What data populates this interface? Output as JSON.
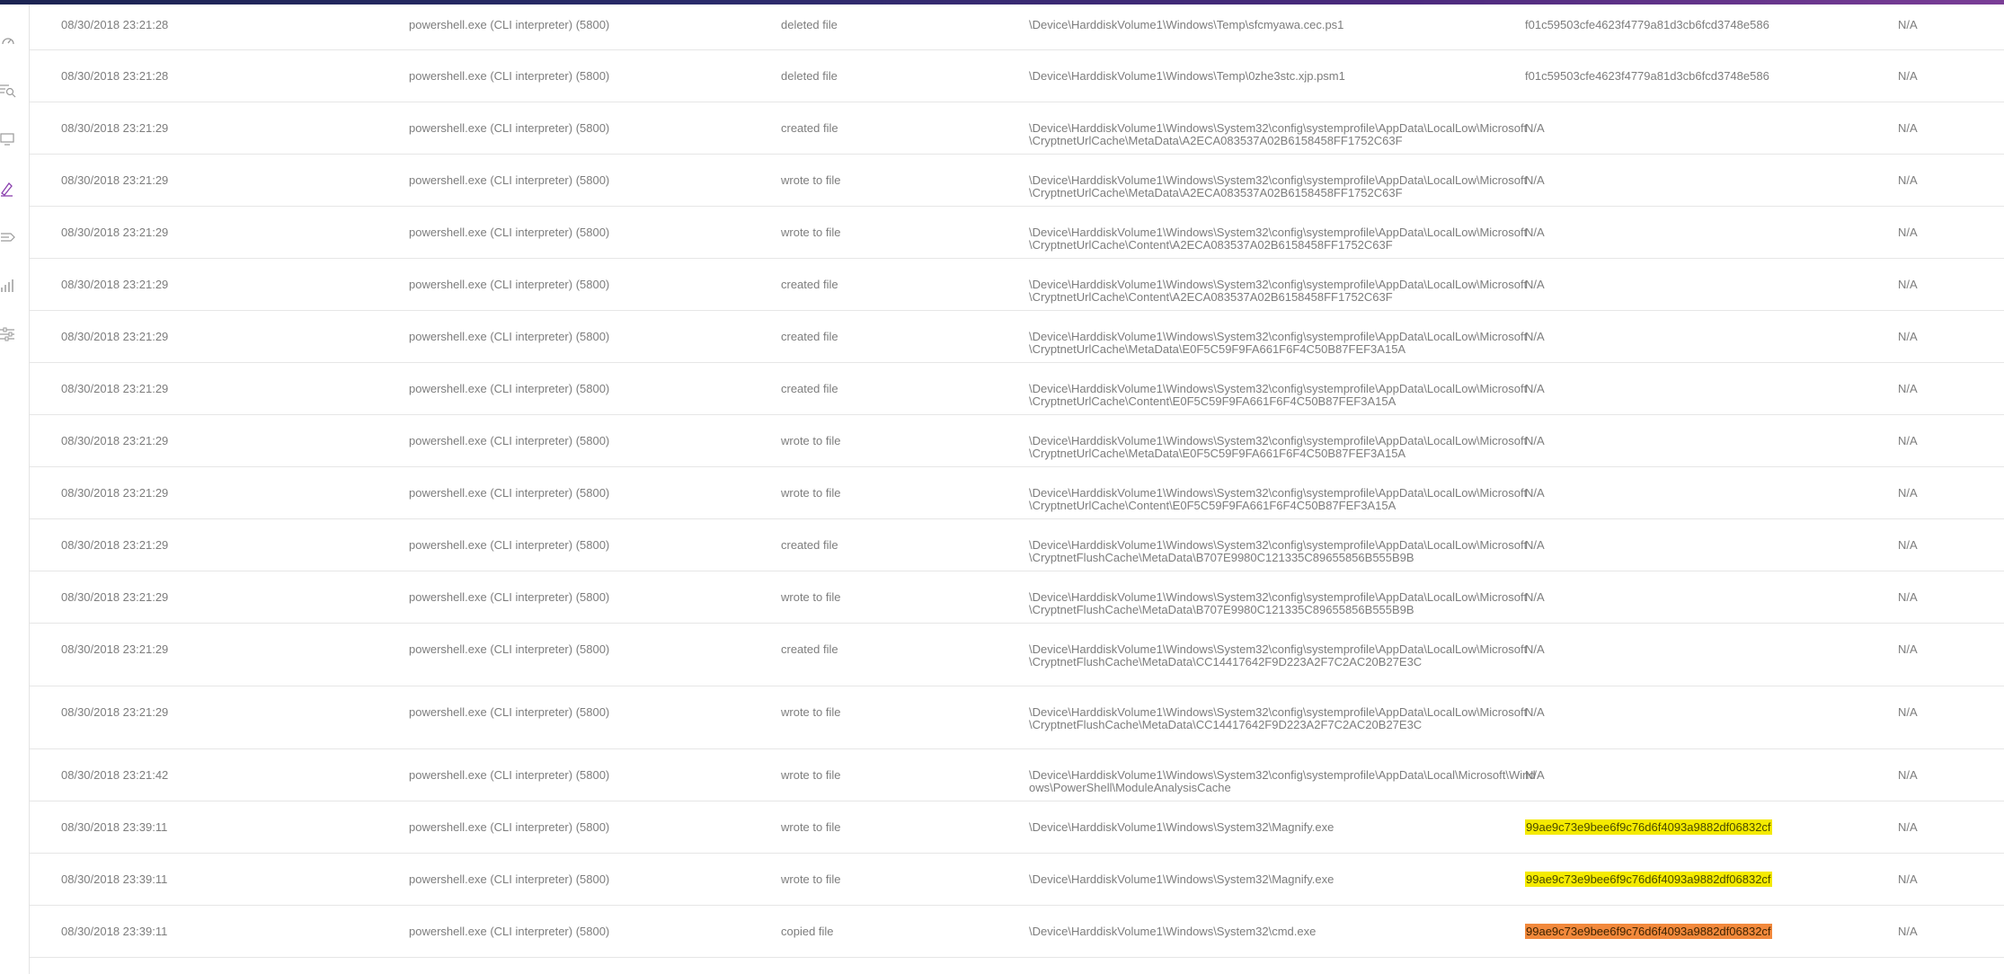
{
  "sidebar": {
    "icons": [
      {
        "name": "dashboard-gauge-icon",
        "active": false
      },
      {
        "name": "search-list-icon",
        "active": false
      },
      {
        "name": "monitor-icon",
        "active": false
      },
      {
        "name": "investigate-icon",
        "active": true
      },
      {
        "name": "routing-icon",
        "active": false
      },
      {
        "name": "bar-chart-icon",
        "active": false
      },
      {
        "name": "sliders-icon",
        "active": false
      }
    ],
    "active_color": "#8a3fae",
    "icon_color": "#9a9a9a"
  },
  "events": [
    {
      "time": "08/30/2018 23:21:28",
      "process": "powershell.exe (CLI interpreter) (5800)",
      "action": "deleted file",
      "path": "\\Device\\HarddiskVolume1\\Windows\\Temp\\sfcmyawa.cec.ps1",
      "hash": "f01c59503cfe4623f4779a81d3cb6fcd3748e586",
      "reputation": "N/A"
    },
    {
      "time": "08/30/2018 23:21:28",
      "process": "powershell.exe (CLI interpreter) (5800)",
      "action": "deleted file",
      "path": "\\Device\\HarddiskVolume1\\Windows\\Temp\\0zhe3stc.xjp.psm1",
      "hash": "f01c59503cfe4623f4779a81d3cb6fcd3748e586",
      "reputation": "N/A"
    },
    {
      "time": "08/30/2018 23:21:29",
      "process": "powershell.exe (CLI interpreter) (5800)",
      "action": "created file",
      "path": "\\Device\\HarddiskVolume1\\Windows\\System32\\config\\systemprofile\\AppData\\LocalLow\\Microsoft\\CryptnetUrlCache\\MetaData\\A2ECA083537A02B6158458FF1752C63F",
      "hash": "N/A",
      "reputation": "N/A"
    },
    {
      "time": "08/30/2018 23:21:29",
      "process": "powershell.exe (CLI interpreter) (5800)",
      "action": "wrote to file",
      "path": "\\Device\\HarddiskVolume1\\Windows\\System32\\config\\systemprofile\\AppData\\LocalLow\\Microsoft\\CryptnetUrlCache\\MetaData\\A2ECA083537A02B6158458FF1752C63F",
      "hash": "N/A",
      "reputation": "N/A"
    },
    {
      "time": "08/30/2018 23:21:29",
      "process": "powershell.exe (CLI interpreter) (5800)",
      "action": "wrote to file",
      "path": "\\Device\\HarddiskVolume1\\Windows\\System32\\config\\systemprofile\\AppData\\LocalLow\\Microsoft\\CryptnetUrlCache\\Content\\A2ECA083537A02B6158458FF1752C63F",
      "hash": "N/A",
      "reputation": "N/A"
    },
    {
      "time": "08/30/2018 23:21:29",
      "process": "powershell.exe (CLI interpreter) (5800)",
      "action": "created file",
      "path": "\\Device\\HarddiskVolume1\\Windows\\System32\\config\\systemprofile\\AppData\\LocalLow\\Microsoft\\CryptnetUrlCache\\Content\\A2ECA083537A02B6158458FF1752C63F",
      "hash": "N/A",
      "reputation": "N/A"
    },
    {
      "time": "08/30/2018 23:21:29",
      "process": "powershell.exe (CLI interpreter) (5800)",
      "action": "created file",
      "path": "\\Device\\HarddiskVolume1\\Windows\\System32\\config\\systemprofile\\AppData\\LocalLow\\Microsoft\\CryptnetUrlCache\\MetaData\\E0F5C59F9FA661F6F4C50B87FEF3A15A",
      "hash": "N/A",
      "reputation": "N/A"
    },
    {
      "time": "08/30/2018 23:21:29",
      "process": "powershell.exe (CLI interpreter) (5800)",
      "action": "created file",
      "path": "\\Device\\HarddiskVolume1\\Windows\\System32\\config\\systemprofile\\AppData\\LocalLow\\Microsoft\\CryptnetUrlCache\\Content\\E0F5C59F9FA661F6F4C50B87FEF3A15A",
      "hash": "N/A",
      "reputation": "N/A"
    },
    {
      "time": "08/30/2018 23:21:29",
      "process": "powershell.exe (CLI interpreter) (5800)",
      "action": "wrote to file",
      "path": "\\Device\\HarddiskVolume1\\Windows\\System32\\config\\systemprofile\\AppData\\LocalLow\\Microsoft\\CryptnetUrlCache\\MetaData\\E0F5C59F9FA661F6F4C50B87FEF3A15A",
      "hash": "N/A",
      "reputation": "N/A"
    },
    {
      "time": "08/30/2018 23:21:29",
      "process": "powershell.exe (CLI interpreter) (5800)",
      "action": "wrote to file",
      "path": "\\Device\\HarddiskVolume1\\Windows\\System32\\config\\systemprofile\\AppData\\LocalLow\\Microsoft\\CryptnetUrlCache\\Content\\E0F5C59F9FA661F6F4C50B87FEF3A15A",
      "hash": "N/A",
      "reputation": "N/A"
    },
    {
      "time": "08/30/2018 23:21:29",
      "process": "powershell.exe (CLI interpreter) (5800)",
      "action": "created file",
      "path": "\\Device\\HarddiskVolume1\\Windows\\System32\\config\\systemprofile\\AppData\\LocalLow\\Microsoft\\CryptnetFlushCache\\MetaData\\B707E9980C121335C89655856B555B9B",
      "hash": "N/A",
      "reputation": "N/A"
    },
    {
      "time": "08/30/2018 23:21:29",
      "process": "powershell.exe (CLI interpreter) (5800)",
      "action": "wrote to file",
      "path": "\\Device\\HarddiskVolume1\\Windows\\System32\\config\\systemprofile\\AppData\\LocalLow\\Microsoft\\CryptnetFlushCache\\MetaData\\B707E9980C121335C89655856B555B9B",
      "hash": "N/A",
      "reputation": "N/A"
    },
    {
      "time": "08/30/2018 23:21:29",
      "process": "powershell.exe (CLI interpreter) (5800)",
      "action": "created file",
      "path": "\\Device\\HarddiskVolume1\\Windows\\System32\\config\\systemprofile\\AppData\\LocalLow\\Microsoft\\CryptnetFlushCache\\MetaData\\CC14417642F9D223A2F7C2AC20B27E3C",
      "hash": "N/A",
      "reputation": "N/A"
    },
    {
      "time": "08/30/2018 23:21:29",
      "process": "powershell.exe (CLI interpreter) (5800)",
      "action": "wrote to file",
      "path": "\\Device\\HarddiskVolume1\\Windows\\System32\\config\\systemprofile\\AppData\\LocalLow\\Microsoft\\CryptnetFlushCache\\MetaData\\CC14417642F9D223A2F7C2AC20B27E3C",
      "hash": "N/A",
      "reputation": "N/A"
    },
    {
      "time": "08/30/2018 23:21:42",
      "process": "powershell.exe (CLI interpreter) (5800)",
      "action": "wrote to file",
      "path": "\\Device\\HarddiskVolume1\\Windows\\System32\\config\\systemprofile\\AppData\\Local\\Microsoft\\Windows\\PowerShell\\ModuleAnalysisCache",
      "hash": "N/A",
      "reputation": "N/A"
    },
    {
      "time": "08/30/2018 23:39:11",
      "process": "powershell.exe (CLI interpreter) (5800)",
      "action": "wrote to file",
      "path": "\\Device\\HarddiskVolume1\\Windows\\System32\\Magnify.exe",
      "hash": "99ae9c73e9bee6f9c76d6f4093a9882df06832cf",
      "highlight": "yellow",
      "reputation": "N/A"
    },
    {
      "time": "08/30/2018 23:39:11",
      "process": "powershell.exe (CLI interpreter) (5800)",
      "action": "wrote to file",
      "path": "\\Device\\HarddiskVolume1\\Windows\\System32\\Magnify.exe",
      "hash": "99ae9c73e9bee6f9c76d6f4093a9882df06832cf",
      "highlight": "yellow",
      "reputation": "N/A"
    },
    {
      "time": "08/30/2018 23:39:11",
      "process": "powershell.exe (CLI interpreter) (5800)",
      "action": "copied file",
      "path": "\\Device\\HarddiskVolume1\\Windows\\System32\\cmd.exe",
      "hash": "99ae9c73e9bee6f9c76d6f4093a9882df06832cf",
      "highlight": "orange",
      "reputation": "N/A"
    }
  ],
  "highlight_colors": {
    "yellow": "#f4ea00",
    "orange": "#f2893c"
  }
}
